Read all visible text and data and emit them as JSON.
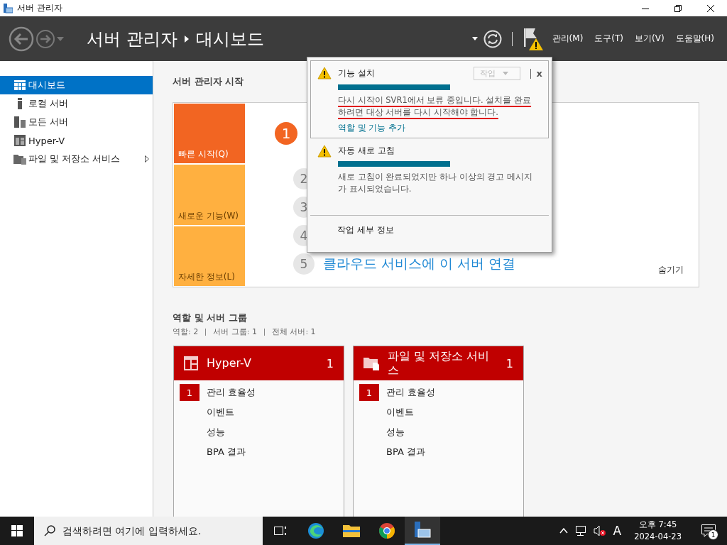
{
  "window": {
    "title": "서버 관리자"
  },
  "header": {
    "breadcrumb": [
      "서버 관리자",
      "대시보드"
    ],
    "menus": [
      "관리(M)",
      "도구(T)",
      "보기(V)",
      "도움말(H)"
    ]
  },
  "sidebar": {
    "items": [
      {
        "label": "대시보드",
        "selected": true,
        "expandable": false
      },
      {
        "label": "로컬 서버",
        "selected": false,
        "expandable": false
      },
      {
        "label": "모든 서버",
        "selected": false,
        "expandable": false
      },
      {
        "label": "Hyper-V",
        "selected": false,
        "expandable": false
      },
      {
        "label": "파일 및 저장소 서비스",
        "selected": false,
        "expandable": true
      }
    ]
  },
  "quick_start": {
    "title": "서버 관리자 시작",
    "tiles": [
      {
        "label": "빠른 시작(Q)",
        "selected": true
      },
      {
        "label": "새로운 기능(W)",
        "selected": false
      },
      {
        "label": "자세한 정보(L)",
        "selected": false
      }
    ],
    "steps": [
      {
        "number": "1",
        "highlighted": true
      },
      {
        "number": "2",
        "highlighted": false
      },
      {
        "number": "3",
        "highlighted": false
      },
      {
        "number": "4",
        "highlighted": false
      },
      {
        "number": "5",
        "highlighted": false,
        "text": "클라우드 서비스에 이 서버 연결"
      }
    ],
    "hide": "숨기기"
  },
  "notifications": {
    "items": [
      {
        "title": "기능 설치",
        "level": 1,
        "selected": true,
        "underlined": true,
        "message": "다시 시작이 SVR1에서 보류 중입니다. 설치를 완료하려면 대상 서버를 다시 시작해야 합니다.",
        "link": "역할 및 기능 추가",
        "action": "작업",
        "close": "x"
      },
      {
        "title": "자동 새로 고침",
        "level": 1,
        "selected": false,
        "underlined": false,
        "message": "새로 고침이 완료되었지만 하나 이상의 경고 메시지가 표시되었습니다."
      }
    ],
    "footer": "작업 세부 정보"
  },
  "roles": {
    "title": "역할 및 서버 그룹",
    "summary": [
      "역할: 2",
      "서버 그룹: 1",
      "전체 서버: 1"
    ],
    "tiles": [
      {
        "title": "Hyper-V",
        "count": "1",
        "rows": [
          {
            "label": "관리 효율성",
            "badge": "1"
          },
          {
            "label": "이벤트"
          },
          {
            "label": "성능"
          },
          {
            "label": "BPA 결과"
          }
        ]
      },
      {
        "title": "파일 및 저장소 서비스",
        "count": "1",
        "rows": [
          {
            "label": "관리 효율성",
            "badge": "1"
          },
          {
            "label": "이벤트"
          },
          {
            "label": "성능"
          },
          {
            "label": "BPA 결과"
          }
        ]
      }
    ]
  },
  "taskbar": {
    "search": {
      "placeholder": "검색하려면 여기에 입력하세요."
    },
    "input_indicator": "A",
    "time": "오후 7:45",
    "date": "2024-04-23",
    "notification_count": "1"
  }
}
